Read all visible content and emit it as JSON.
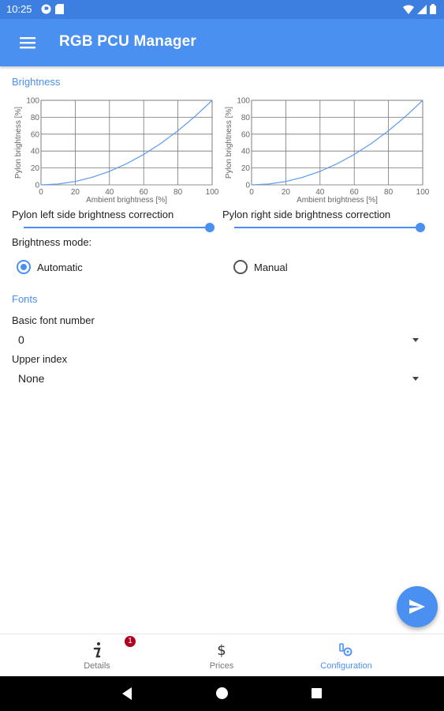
{
  "status_bar": {
    "time": "10:25"
  },
  "app_bar": {
    "title": "RGB PCU Manager"
  },
  "brightness": {
    "section_title": "Brightness",
    "left_chart": {
      "xlabel": "Ambient brightness [%]",
      "ylabel": "Pylon brightness [%]",
      "slider_label": "Pylon left side brightness correction",
      "slider_value": 1.0
    },
    "right_chart": {
      "xlabel": "Ambient brightness [%]",
      "ylabel": "Pylon brightness [%]",
      "slider_label": "Pylon right side brightness correction",
      "slider_value": 1.0
    },
    "mode_label": "Brightness mode:",
    "mode_options": [
      "Automatic",
      "Manual"
    ],
    "mode_selected": "Automatic"
  },
  "fonts": {
    "section_title": "Fonts",
    "basic_font_label": "Basic font number",
    "basic_font_value": "0",
    "upper_index_label": "Upper index",
    "upper_index_value": "None"
  },
  "bottom_nav": {
    "items": [
      {
        "label": "Details",
        "icon": "info-icon",
        "badge": "1"
      },
      {
        "label": "Prices",
        "icon": "dollar-icon"
      },
      {
        "label": "Configuration",
        "icon": "configuration-icon",
        "active": true
      }
    ]
  },
  "colors": {
    "primary": "#4a90f0",
    "status_bar": "#3d7fe0",
    "badge": "#b00020"
  },
  "chart_data": [
    {
      "type": "line",
      "xlabel": "Ambient brightness [%]",
      "ylabel": "Pylon brightness [%]",
      "xlim": [
        0,
        100
      ],
      "ylim": [
        0,
        100
      ],
      "x_ticks": [
        0,
        20,
        40,
        60,
        80,
        100
      ],
      "y_ticks": [
        20,
        40,
        60,
        80,
        100
      ],
      "grid": true,
      "series": [
        {
          "x": [
            0,
            10,
            20,
            30,
            40,
            50,
            60,
            70,
            80,
            90,
            100
          ],
          "y": [
            0,
            1,
            4,
            9,
            16,
            25,
            36,
            49,
            64,
            81,
            100
          ]
        }
      ]
    },
    {
      "type": "line",
      "xlabel": "Ambient brightness [%]",
      "ylabel": "Pylon brightness [%]",
      "xlim": [
        0,
        100
      ],
      "ylim": [
        0,
        100
      ],
      "x_ticks": [
        0,
        20,
        40,
        60,
        80,
        100
      ],
      "y_ticks": [
        20,
        40,
        60,
        80,
        100
      ],
      "grid": true,
      "series": [
        {
          "x": [
            0,
            10,
            20,
            30,
            40,
            50,
            60,
            70,
            80,
            90,
            100
          ],
          "y": [
            0,
            1,
            4,
            9,
            16,
            25,
            36,
            49,
            64,
            81,
            100
          ]
        }
      ]
    }
  ]
}
